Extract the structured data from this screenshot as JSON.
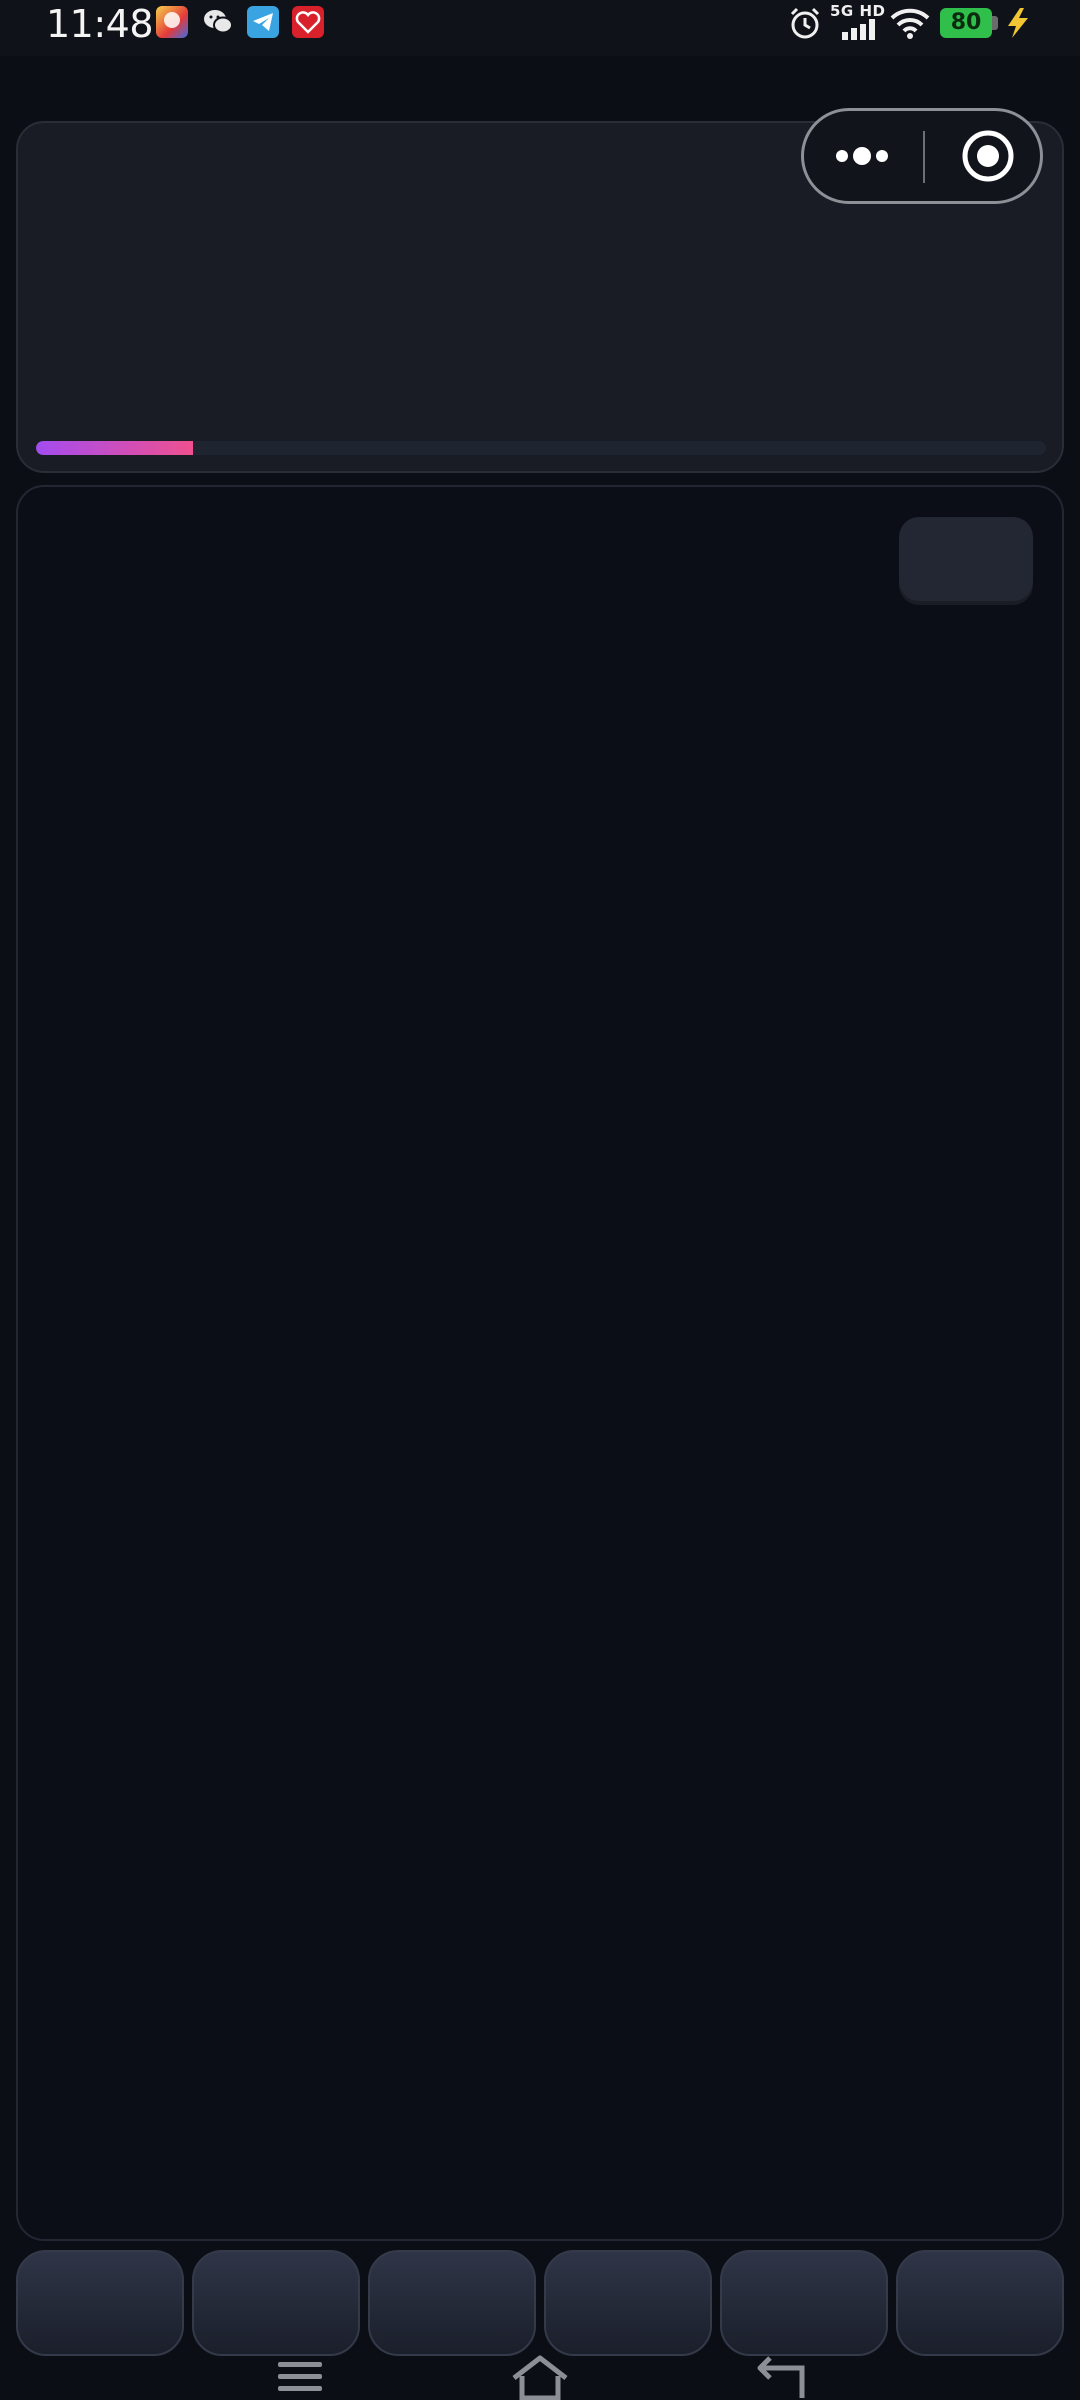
{
  "status_bar": {
    "time": "11:48",
    "network": "5G HD",
    "battery": "80",
    "notification_icons": [
      "game-app-icon",
      "wechat-icon",
      "telegram-icon",
      "red-app-icon"
    ],
    "system_icons": [
      "alarm-icon",
      "signal-icon",
      "wifi-icon",
      "battery-icon",
      "charging-icon"
    ]
  },
  "capsule": {
    "icons": [
      "more-dots-icon",
      "close-target-icon"
    ]
  },
  "top_panel": {
    "progress": 0.155,
    "progress_colors": [
      "#a44cf0",
      "#f0508f"
    ]
  },
  "tab_bar": {
    "tabs": [
      "",
      "",
      "",
      "",
      "",
      ""
    ]
  },
  "system_nav": {
    "icons": [
      "menu-icon",
      "home-icon",
      "back-icon"
    ]
  },
  "colors": {
    "background": "#0b0e15",
    "panel": "#191c24",
    "battery": "#2fbf4a"
  }
}
